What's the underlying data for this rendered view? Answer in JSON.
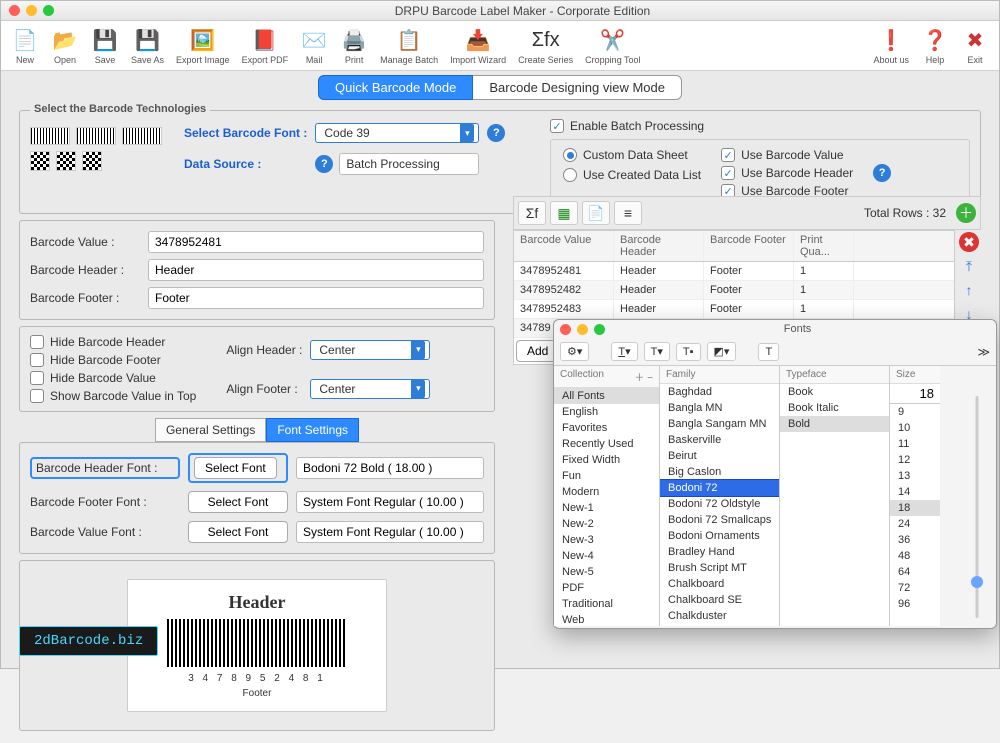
{
  "title": "DRPU Barcode Label Maker - Corporate Edition",
  "toolbar": [
    {
      "label": "New",
      "icon": "📄"
    },
    {
      "label": "Open",
      "icon": "📂"
    },
    {
      "label": "Save",
      "icon": "💾"
    },
    {
      "label": "Save As",
      "icon": "💾"
    },
    {
      "label": "Export Image",
      "icon": "🖼️"
    },
    {
      "label": "Export PDF",
      "icon": "📕"
    },
    {
      "label": "Mail",
      "icon": "✉️"
    },
    {
      "label": "Print",
      "icon": "🖨️"
    },
    {
      "label": "Manage Batch",
      "icon": "📋"
    },
    {
      "label": "Import Wizard",
      "icon": "📥"
    },
    {
      "label": "Create Series",
      "icon": "Σfx"
    },
    {
      "label": "Cropping Tool",
      "icon": "✂️"
    }
  ],
  "toolbar_right": [
    {
      "label": "About us",
      "icon": "❗"
    },
    {
      "label": "Help",
      "icon": "❓"
    },
    {
      "label": "Exit",
      "icon": "✖"
    }
  ],
  "mode_tabs": {
    "quick": "Quick Barcode Mode",
    "design": "Barcode Designing view Mode"
  },
  "tech": {
    "legend": "Select the Barcode Technologies",
    "font_label": "Select Barcode Font :",
    "font_value": "Code 39",
    "source_label": "Data Source :",
    "source_value": "Batch Processing"
  },
  "batch": {
    "enable": "Enable Batch Processing",
    "custom": "Custom Data Sheet",
    "created": "Use Created Data List",
    "use_value": "Use Barcode Value",
    "use_header": "Use Barcode Header",
    "use_footer": "Use Barcode Footer"
  },
  "fields": {
    "value_label": "Barcode Value :",
    "value": "3478952481",
    "header_label": "Barcode Header :",
    "header": "Header",
    "footer_label": "Barcode Footer :",
    "footer": "Footer"
  },
  "hide": {
    "hheader": "Hide Barcode Header",
    "hfooter": "Hide Barcode Footer",
    "hvalue": "Hide Barcode Value",
    "showtop": "Show Barcode Value in Top",
    "align_header_label": "Align Header :",
    "align_header": "Center",
    "align_footer_label": "Align Footer :",
    "align_footer": "Center"
  },
  "settings_tabs": {
    "general": "General Settings",
    "font": "Font Settings"
  },
  "fonts_section": {
    "header_font_label": "Barcode Header Font :",
    "footer_font_label": "Barcode Footer Font :",
    "value_font_label": "Barcode Value Font :",
    "select_btn": "Select Font",
    "header_font": "Bodoni 72 Bold ( 18.00 )",
    "footer_font": "System Font Regular ( 10.00 )",
    "value_font": "System Font Regular ( 10.00 )"
  },
  "preview": {
    "header": "Header",
    "value": "3 4 7 8 9 5 2 4 8 1",
    "footer": "Footer"
  },
  "grid": {
    "total_label": "Total Rows :",
    "total": "32",
    "add_btn": "Add",
    "cols": {
      "value": "Barcode Value",
      "header": "Barcode Header",
      "footer": "Barcode Footer",
      "qty": "Print Qua..."
    },
    "rows": [
      {
        "v": "3478952481",
        "h": "Header",
        "f": "Footer",
        "q": "1"
      },
      {
        "v": "3478952482",
        "h": "Header",
        "f": "Footer",
        "q": "1"
      },
      {
        "v": "3478952483",
        "h": "Header",
        "f": "Footer",
        "q": "1"
      },
      {
        "v": "34789",
        "h": "",
        "f": "",
        "q": ""
      }
    ]
  },
  "fonts_panel": {
    "title": "Fonts",
    "col_collection": "Collection",
    "col_family": "Family",
    "col_typeface": "Typeface",
    "col_size": "Size",
    "size_value": "18",
    "collections": [
      "All Fonts",
      "English",
      "Favorites",
      "Recently Used",
      "Fixed Width",
      "Fun",
      "Modern",
      "New-1",
      "New-2",
      "New-3",
      "New-4",
      "New-5",
      "PDF",
      "Traditional",
      "Web"
    ],
    "families": [
      "Baghdad",
      "Bangla MN",
      "Bangla Sangam MN",
      "Baskerville",
      "Beirut",
      "Big Caslon",
      "Bodoni 72",
      "Bodoni 72 Oldstyle",
      "Bodoni 72 Smallcaps",
      "Bodoni Ornaments",
      "Bradley Hand",
      "Brush Script MT",
      "Chalkboard",
      "Chalkboard SE",
      "Chalkduster"
    ],
    "typefaces": [
      "Book",
      "Book Italic",
      "Bold"
    ],
    "sizes": [
      "9",
      "10",
      "11",
      "12",
      "13",
      "14",
      "18",
      "24",
      "36",
      "48",
      "64",
      "72",
      "96"
    ]
  },
  "watermark": "2dBarcode.biz"
}
